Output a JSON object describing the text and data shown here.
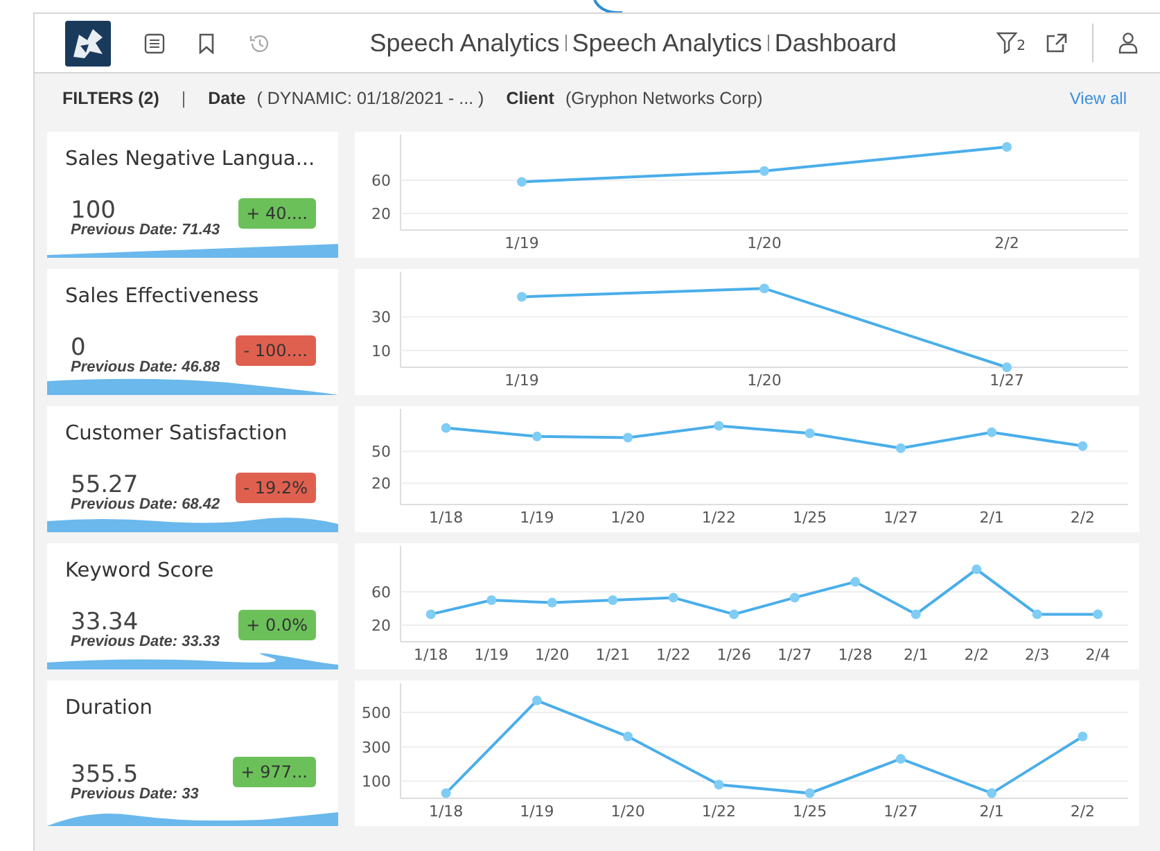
{
  "header": {
    "breadcrumbs": [
      "Speech Analytics",
      "Speech Analytics",
      "Dashboard"
    ],
    "filter_count": "2"
  },
  "filters": {
    "label": "FILTERS (2)",
    "separator": "|",
    "items": [
      {
        "name": "Date",
        "value": "( DYNAMIC: 01/18/2021 - ... )"
      },
      {
        "name": "Client",
        "value": "(Gryphon Networks Corp)"
      }
    ],
    "view_all": "View all"
  },
  "metrics": [
    {
      "title": "Sales Negative Langua...",
      "value": "100",
      "previous": "Previous Date: 71.43",
      "change": "+ 40....",
      "color": "#6cc05a",
      "chart_data": {
        "type": "line",
        "categories": [
          "1/19",
          "1/20",
          "2/2"
        ],
        "series": [
          {
            "color": "#4aaeea",
            "marker": true,
            "values": [
              58,
              71,
              100
            ]
          }
        ],
        "ylim": [
          0,
          115
        ],
        "yticks": [
          20,
          60
        ],
        "grid": true
      }
    },
    {
      "title": "Sales Effectiveness",
      "value": "0",
      "previous": "Previous Date: 46.88",
      "change": "- 100....",
      "color": "#e0604f",
      "chart_data": {
        "type": "line",
        "categories": [
          "1/19",
          "1/20",
          "1/27"
        ],
        "series": [
          {
            "color": "#4aaeea",
            "marker": true,
            "values": [
              42,
              47,
              0
            ]
          }
        ],
        "ylim": [
          0,
          57
        ],
        "yticks": [
          10,
          30
        ],
        "grid": true
      }
    },
    {
      "title": "Customer Satisfaction",
      "value": "55.27",
      "previous": "Previous Date: 68.42",
      "change": "- 19.2%",
      "color": "#e0604f",
      "chart_data": {
        "type": "line",
        "categories": [
          "1/18",
          "1/19",
          "1/20",
          "1/22",
          "1/25",
          "1/27",
          "2/1",
          "2/2"
        ],
        "series": [
          {
            "color": "#4aaeea",
            "marker": true,
            "values": [
              72,
              64,
              63,
              74,
              67,
              53,
              68,
              55
            ]
          }
        ],
        "ylim": [
          0,
          90
        ],
        "yticks": [
          20,
          50
        ],
        "grid": true
      }
    },
    {
      "title": "Keyword Score",
      "value": "33.34",
      "previous": "Previous Date: 33.33",
      "change": "+ 0.0%",
      "color": "#6cc05a",
      "chart_data": {
        "type": "line",
        "categories": [
          "1/18",
          "1/19",
          "1/20",
          "1/21",
          "1/22",
          "1/26",
          "1/27",
          "1/28",
          "2/1",
          "2/2",
          "2/3",
          "2/4"
        ],
        "series": [
          {
            "color": "#4aaeea",
            "marker": true,
            "values": [
              33,
              50,
              47,
              50,
              53,
              33,
              53,
              72,
              33,
              87,
              33,
              33
            ]
          }
        ],
        "ylim": [
          0,
          115
        ],
        "yticks": [
          20,
          60
        ],
        "grid": true
      }
    },
    {
      "title": "Duration",
      "value": "355.5",
      "previous": "Previous Date: 33",
      "change": "+ 977...",
      "color": "#6cc05a",
      "chart_data": {
        "type": "line",
        "categories": [
          "1/18",
          "1/19",
          "1/20",
          "1/22",
          "1/25",
          "1/27",
          "2/1",
          "2/2"
        ],
        "series": [
          {
            "color": "#4aaeea",
            "marker": true,
            "values": [
              30,
              570,
              360,
              80,
              30,
              230,
              30,
              360
            ]
          }
        ],
        "ylim": [
          0,
          670
        ],
        "yticks": [
          100,
          300,
          500
        ],
        "grid": true
      }
    }
  ]
}
